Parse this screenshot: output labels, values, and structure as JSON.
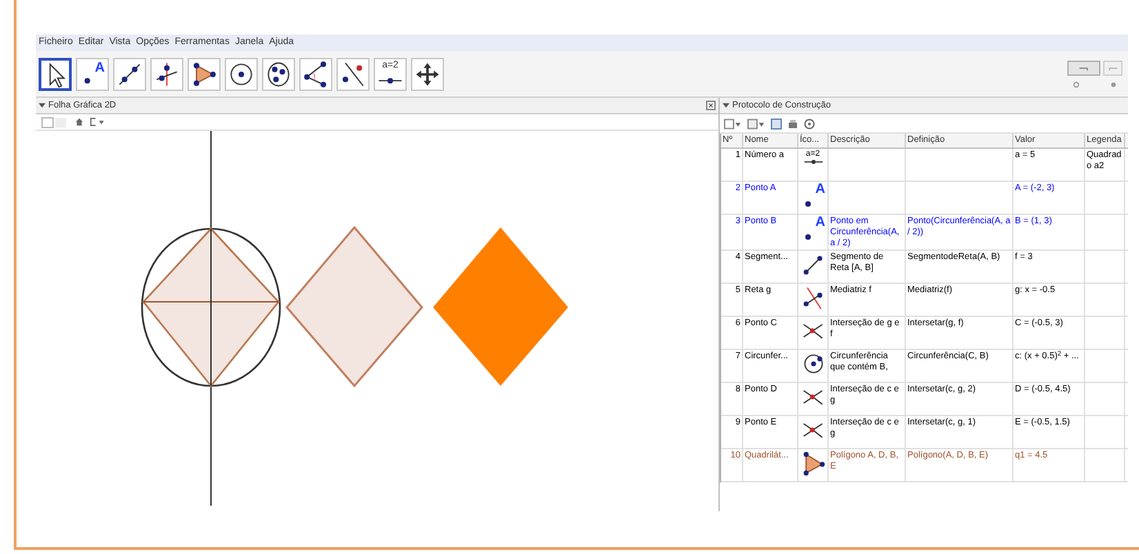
{
  "menu": [
    "Ficheiro",
    "Editar",
    "Vista",
    "Opções",
    "Ferramentas",
    "Janela",
    "Ajuda"
  ],
  "tools": [
    {
      "kind": "move",
      "selected": true
    },
    {
      "kind": "point",
      "selected": false,
      "text": "A"
    },
    {
      "kind": "line",
      "selected": false
    },
    {
      "kind": "perpendicular",
      "selected": false
    },
    {
      "kind": "polygon",
      "selected": false
    },
    {
      "kind": "circle",
      "selected": false
    },
    {
      "kind": "conic",
      "selected": false
    },
    {
      "kind": "angle",
      "selected": false
    },
    {
      "kind": "reflect",
      "selected": false
    },
    {
      "kind": "slider",
      "selected": false,
      "text": "a=2"
    },
    {
      "kind": "pan",
      "selected": false
    }
  ],
  "graphics_panel": {
    "title": "Folha Gráfica 2D"
  },
  "protocol_panel": {
    "title": "Protocolo de Construção",
    "columns": [
      "Nº",
      "Nome",
      "Íco...",
      "Descrição",
      "Definição",
      "Valor",
      "Legenda"
    ],
    "rows": [
      {
        "number": "1",
        "name": "Número a",
        "kind": "slider",
        "icon_text": "a=2",
        "description": "",
        "definition": "",
        "value": "a = 5",
        "caption": "Quadrado a2",
        "color": "#000000"
      },
      {
        "number": "2",
        "name": "Ponto A",
        "kind": "point",
        "icon_text": "A",
        "description": "",
        "definition": "",
        "value": "A = (-2, 3)",
        "caption": "",
        "color": "#0000ff"
      },
      {
        "number": "3",
        "name": "Ponto B",
        "kind": "point",
        "icon_text": "A",
        "description": "Ponto em Circunferência(A, a / 2)",
        "definition": "Ponto(Circunferência(A, a / 2))",
        "value": "B = (1, 3)",
        "caption": "",
        "color": "#0000ff"
      },
      {
        "number": "4",
        "name": "Segment...",
        "kind": "segment",
        "description": "Segmento de Reta [A, B]",
        "definition": "SegmentodeReta(A, B)",
        "value": "f = 3",
        "caption": "",
        "color": "#000000"
      },
      {
        "number": "5",
        "name": "Reta g",
        "kind": "perpendicular",
        "description": "Mediatriz f",
        "definition": "Mediatriz(f)",
        "value": "g: x = -0.5",
        "caption": "",
        "color": "#000000"
      },
      {
        "number": "6",
        "name": "Ponto C",
        "kind": "intersect",
        "description": "Interseção de g e f",
        "definition": "Intersetar(g, f)",
        "value": "C = (-0.5, 3)",
        "caption": "",
        "color": "#000000"
      },
      {
        "number": "7",
        "name": "Circunfer...",
        "kind": "circle",
        "description": "Circunferência que contém B,",
        "definition": "Circunferência(C, B)",
        "value": "c: (x + 0.5)$^{2}$ + ...",
        "caption": "",
        "color": "#000000"
      },
      {
        "number": "8",
        "name": "Ponto D",
        "kind": "intersect",
        "description": "Interseção de c e g",
        "definition": "Intersetar(c, g, 2)",
        "value": "D = (-0.5, 4.5)",
        "caption": "",
        "color": "#000000"
      },
      {
        "number": "9",
        "name": "Ponto E",
        "kind": "intersect",
        "description": "Interseção de c e g",
        "definition": "Intersetar(c, g, 1)",
        "value": "E = (-0.5, 1.5)",
        "caption": "",
        "color": "#000000"
      },
      {
        "number": "10",
        "name": "Quadrilát...",
        "kind": "polygon",
        "description": "Polígono A, D, B, E",
        "definition": "Polígono(A, D, B, E)",
        "value": "q1 = 4.5",
        "caption": "",
        "color": "#a0522d"
      }
    ]
  }
}
